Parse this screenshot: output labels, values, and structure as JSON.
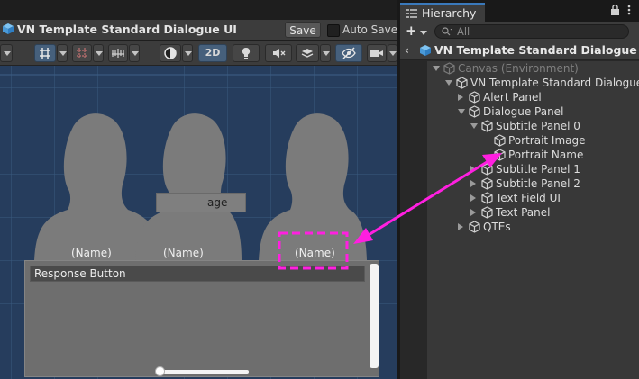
{
  "scene": {
    "title": "VN Template Standard Dialogue UI",
    "save_label": "Save",
    "autosave_label": "Auto Save",
    "toolbar": {
      "two_d_label": "2D"
    },
    "portraits": [
      {
        "name": "(Name)"
      },
      {
        "name": "(Name)"
      },
      {
        "name": "(Name)"
      }
    ],
    "ghost_button_text": "age",
    "response_button_label": "Response Button"
  },
  "hierarchy": {
    "tab_label": "Hierarchy",
    "search_placeholder": "All",
    "header_title": "VN Template Standard Dialogue UI*",
    "items": [
      {
        "label": "Canvas (Environment)",
        "depth": 0,
        "expanded": true,
        "dim": true
      },
      {
        "label": "VN Template Standard Dialogue UI",
        "depth": 1,
        "expanded": true
      },
      {
        "label": "Alert Panel",
        "depth": 2,
        "expanded": false
      },
      {
        "label": "Dialogue Panel",
        "depth": 2,
        "expanded": true
      },
      {
        "label": "Subtitle Panel 0",
        "depth": 3,
        "expanded": true
      },
      {
        "label": "Portrait Image",
        "depth": 4
      },
      {
        "label": "Portrait Name",
        "depth": 4
      },
      {
        "label": "Subtitle Panel 1",
        "depth": 3,
        "expanded": false
      },
      {
        "label": "Subtitle Panel 2",
        "depth": 3,
        "expanded": false
      },
      {
        "label": "Text Field UI",
        "depth": 3,
        "expanded": false
      },
      {
        "label": "Text Panel",
        "depth": 3,
        "expanded": false
      },
      {
        "label": "QTEs",
        "depth": 2,
        "expanded": false
      }
    ]
  },
  "colors": {
    "annotation": "#ff1fe0",
    "scene_bg": "#263d5d",
    "active_tab": "#3a79bb"
  }
}
